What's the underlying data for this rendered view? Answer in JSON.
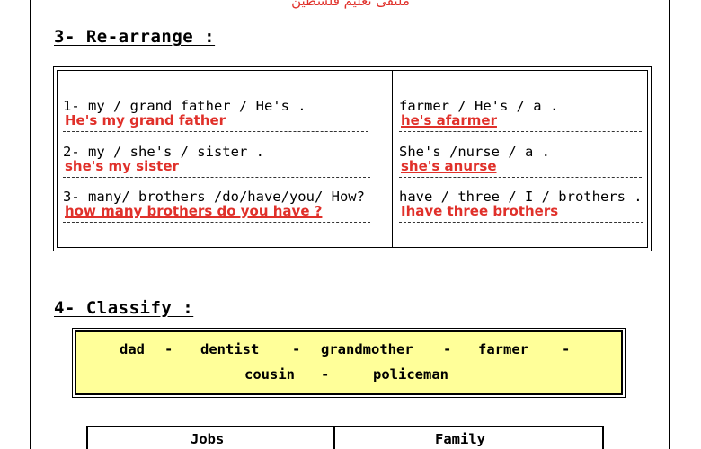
{
  "header": {
    "watermark": "ملتقى تعليم فلسطين"
  },
  "rearrange": {
    "title": "3- Re-arrange :",
    "left": [
      {
        "prompt": "1- my / grand father / He's .",
        "answer": "He's my grand father"
      },
      {
        "prompt": "2- my / she's / sister  .",
        "answer": "she's my sister"
      },
      {
        "prompt": "3- many/ brothers /do/have/you/ How?",
        "answer": "how many brothers do you have ?"
      }
    ],
    "right": [
      {
        "prompt": "farmer / He's / a .",
        "answer": "he's afarmer"
      },
      {
        "prompt": " She's /nurse / a .",
        "answer": "she's anurse"
      },
      {
        "prompt": " have / three / I / brothers .",
        "answer": "Ihave three brothers"
      }
    ]
  },
  "classify": {
    "title": "4- Classify :",
    "words": [
      "dad",
      "dentist",
      "grandmother",
      "farmer",
      "cousin",
      "policeman"
    ],
    "separator": "-",
    "columns": [
      "Jobs",
      "Family"
    ]
  }
}
